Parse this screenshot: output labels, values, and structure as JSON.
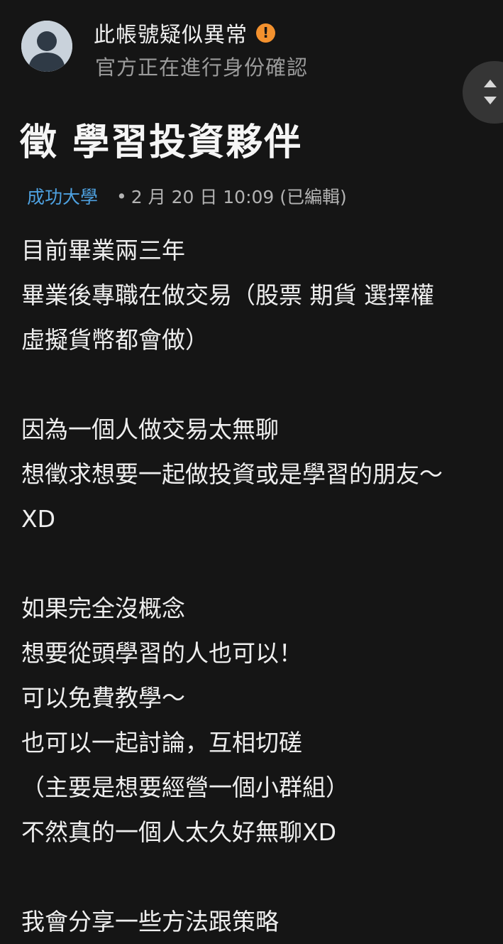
{
  "author": {
    "name": "此帳號疑似異常",
    "verification_note": "官方正在進行身份確認",
    "warning_icon": "exclamation-circle-icon",
    "warning_color": "#f3912e"
  },
  "post": {
    "title": "徵 學習投資夥伴",
    "school": "成功大學",
    "separator": "•",
    "timestamp": "2 月 20 日 10:09 (已編輯)",
    "lines": [
      "目前畢業兩三年",
      "畢業後專職在做交易（股票 期貨 選擇權",
      "虛擬貨幣都會做）",
      "",
      "因為一個人做交易太無聊",
      "想徵求想要一起做投資或是學習的朋友～",
      "XD",
      "",
      "如果完全沒概念",
      "想要從頭學習的人也可以！",
      "可以免費教學～",
      "也可以一起討論，互相切磋",
      "（主要是想要經營一個小群組）",
      "不然真的一個人太久好無聊XD",
      "",
      "我會分享一些方法跟策略"
    ]
  },
  "colors": {
    "background": "#151515",
    "link": "#4ea1e0",
    "muted_text": "#9b9b9b"
  }
}
